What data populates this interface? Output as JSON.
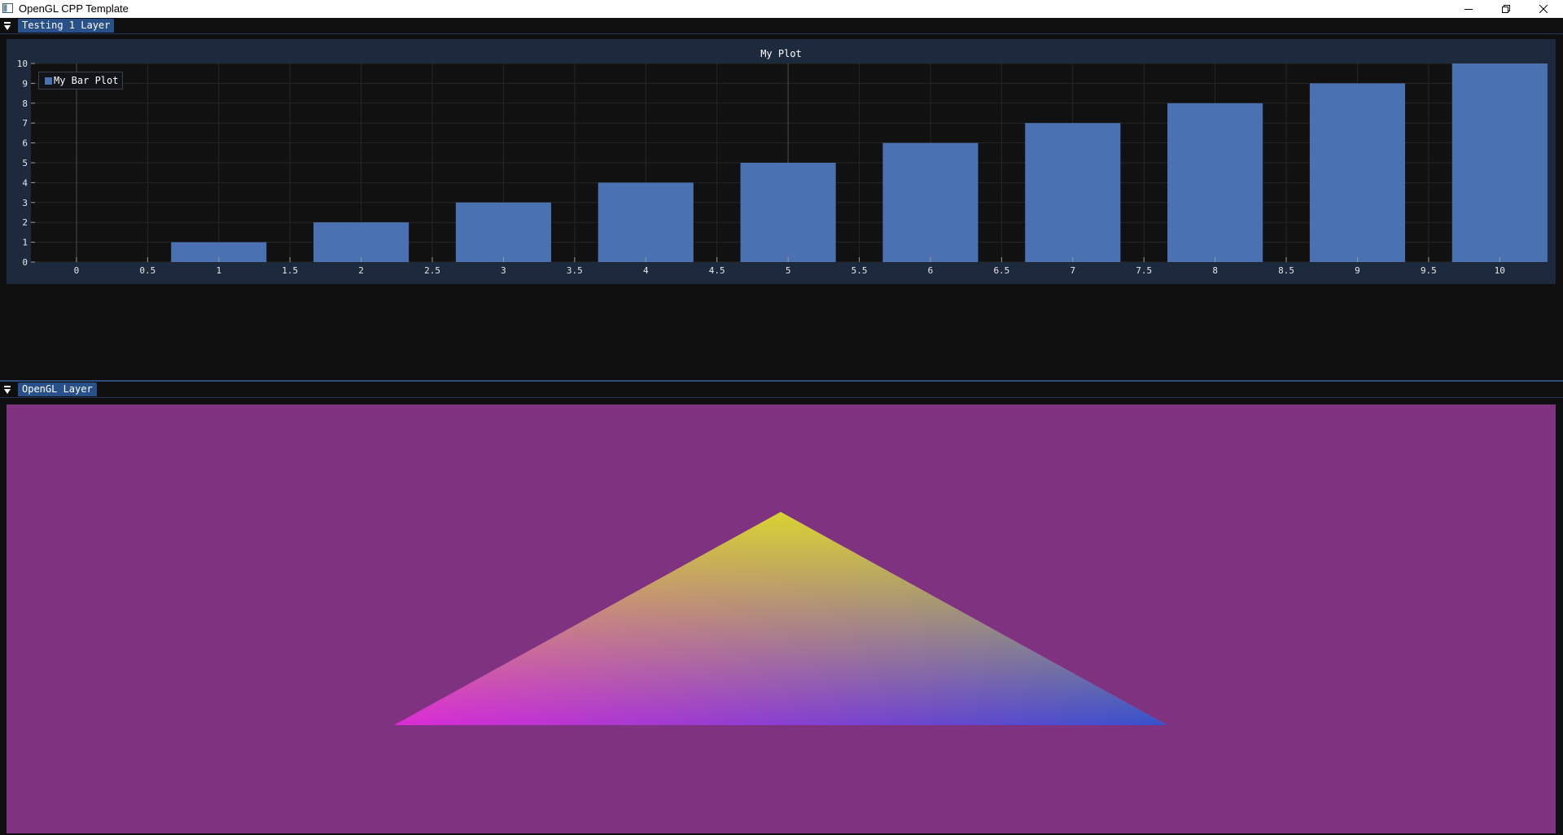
{
  "window": {
    "title": "OpenGL CPP Template",
    "controls": [
      "minimize",
      "restore",
      "close"
    ]
  },
  "panel_top": {
    "tab_label": "Testing 1 Layer"
  },
  "plot": {
    "title": "My Plot",
    "legend_label": "My Bar Plot"
  },
  "chart_data": {
    "type": "bar",
    "title": "My Plot",
    "x": [
      1,
      2,
      3,
      4,
      5,
      6,
      7,
      8,
      9,
      10
    ],
    "series": [
      {
        "name": "My Bar Plot",
        "values": [
          1,
          2,
          3,
          4,
          5,
          6,
          7,
          8,
          9,
          10
        ]
      }
    ],
    "bar_width": 0.67,
    "xlim": [
      -0.32,
      10.33
    ],
    "ylim": [
      0,
      10
    ],
    "x_ticks": [
      "0",
      "0.5",
      "1",
      "1.5",
      "2",
      "2.5",
      "3",
      "3.5",
      "4",
      "4.5",
      "5",
      "5.5",
      "6",
      "6.5",
      "7",
      "7.5",
      "8",
      "8.5",
      "9",
      "9.5",
      "10"
    ],
    "y_ticks": [
      "0",
      "1",
      "2",
      "3",
      "4",
      "5",
      "6",
      "7",
      "8",
      "9",
      "10"
    ],
    "xlabel": "",
    "ylabel": "",
    "grid": true,
    "legend_position": "top-left",
    "bar_color": "#4a71b1"
  },
  "panel_bottom": {
    "tab_label": "OpenGL Layer"
  },
  "colors": {
    "accent": "#295089",
    "clear_color": "#7f327f",
    "vertex_top": "#d8d331",
    "vertex_left": "#dd2bd6",
    "vertex_right": "#3652cc"
  },
  "icons": {
    "app": "window-app-icon",
    "collapse": "triangle-down-icon"
  }
}
